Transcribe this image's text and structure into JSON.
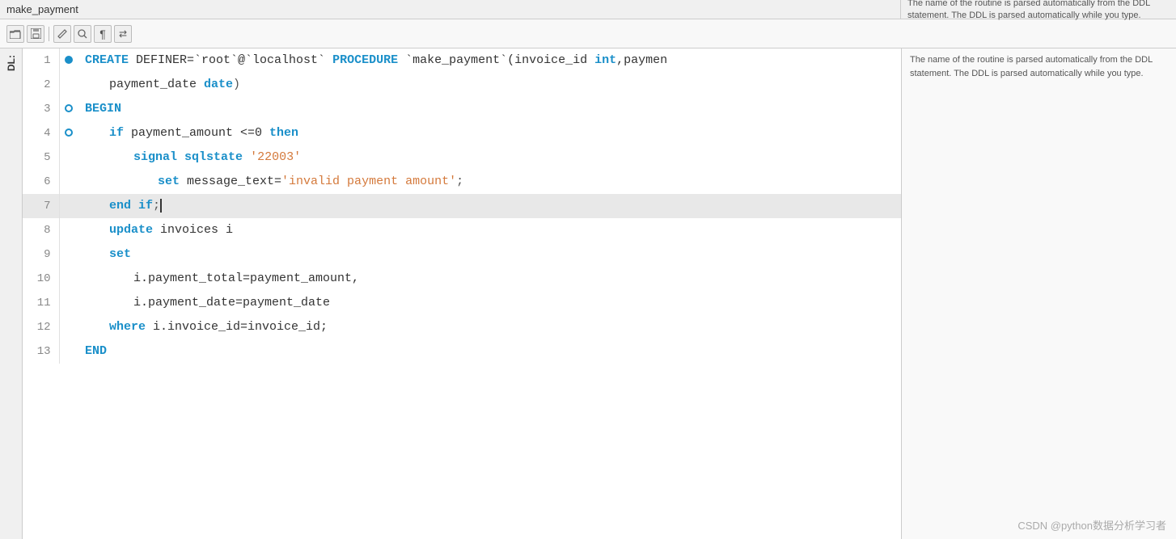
{
  "header": {
    "title": "make_payment",
    "right_description": "The name of the routine is parsed automatically from the DDL statement. The DDL is parsed automatically while you type."
  },
  "toolbar": {
    "buttons": [
      {
        "name": "open-folder-btn",
        "icon": "📁"
      },
      {
        "name": "save-btn",
        "icon": "💾"
      },
      {
        "name": "pencil-btn",
        "icon": "✏️"
      },
      {
        "name": "search-btn",
        "icon": "🔍"
      },
      {
        "name": "paragraph-btn",
        "icon": "¶"
      },
      {
        "name": "arrows-btn",
        "icon": "⇄"
      }
    ]
  },
  "dl_label": "DL:",
  "lines": [
    {
      "num": 1,
      "gutter": "dot-blue",
      "indent": 0,
      "tokens": [
        {
          "t": "CREATE",
          "c": "kw"
        },
        {
          "t": " DEFINER=`root`@`localhost` ",
          "c": "ident"
        },
        {
          "t": "PROCEDURE",
          "c": "kw"
        },
        {
          "t": " `make_payment`(invoice_id ",
          "c": "ident"
        },
        {
          "t": "int",
          "c": "kw"
        },
        {
          "t": ",paymen",
          "c": "ident"
        }
      ]
    },
    {
      "num": 2,
      "gutter": "",
      "indent": 1,
      "tokens": [
        {
          "t": "payment_date ",
          "c": "ident"
        },
        {
          "t": "date",
          "c": "kw"
        },
        {
          "t": ")",
          "c": "sym"
        }
      ]
    },
    {
      "num": 3,
      "gutter": "dot-outline",
      "indent": 0,
      "tokens": [
        {
          "t": "BEGIN",
          "c": "kw"
        }
      ]
    },
    {
      "num": 4,
      "gutter": "dot-outline",
      "indent": 1,
      "tokens": [
        {
          "t": "if",
          "c": "kw"
        },
        {
          "t": " payment_amount <=0 ",
          "c": "ident"
        },
        {
          "t": "then",
          "c": "kw"
        }
      ]
    },
    {
      "num": 5,
      "gutter": "",
      "indent": 2,
      "tokens": [
        {
          "t": "signal",
          "c": "kw"
        },
        {
          "t": " ",
          "c": "ident"
        },
        {
          "t": "sqlstate",
          "c": "kw"
        },
        {
          "t": " ",
          "c": "ident"
        },
        {
          "t": "'22003'",
          "c": "str"
        }
      ]
    },
    {
      "num": 6,
      "gutter": "",
      "indent": 3,
      "tokens": [
        {
          "t": "set",
          "c": "kw"
        },
        {
          "t": " message_text=",
          "c": "ident"
        },
        {
          "t": "'invalid payment amount'",
          "c": "str"
        },
        {
          "t": ";",
          "c": "sym"
        }
      ]
    },
    {
      "num": 7,
      "gutter": "",
      "indent": 1,
      "highlighted": true,
      "tokens": [
        {
          "t": "end",
          "c": "kw"
        },
        {
          "t": " ",
          "c": "ident"
        },
        {
          "t": "if",
          "c": "kw"
        },
        {
          "t": ";",
          "c": "sym"
        },
        {
          "t": "│",
          "c": "cursor"
        }
      ]
    },
    {
      "num": 8,
      "gutter": "",
      "indent": 1,
      "tokens": [
        {
          "t": "update",
          "c": "kw"
        },
        {
          "t": " invoices i",
          "c": "ident"
        }
      ]
    },
    {
      "num": 9,
      "gutter": "",
      "indent": 1,
      "tokens": [
        {
          "t": "set",
          "c": "kw"
        }
      ]
    },
    {
      "num": 10,
      "gutter": "",
      "indent": 2,
      "tokens": [
        {
          "t": "i.payment_total=payment_amount,",
          "c": "ident"
        }
      ]
    },
    {
      "num": 11,
      "gutter": "",
      "indent": 2,
      "tokens": [
        {
          "t": "i.payment_date=payment_date",
          "c": "ident"
        }
      ]
    },
    {
      "num": 12,
      "gutter": "",
      "indent": 1,
      "tokens": [
        {
          "t": "where",
          "c": "kw"
        },
        {
          "t": " i.invoice_id=invoice_id;",
          "c": "ident"
        }
      ]
    },
    {
      "num": 13,
      "gutter": "",
      "indent": 0,
      "tokens": [
        {
          "t": "END",
          "c": "kw"
        }
      ]
    }
  ],
  "watermark": "CSDN @python数据分析学习者"
}
